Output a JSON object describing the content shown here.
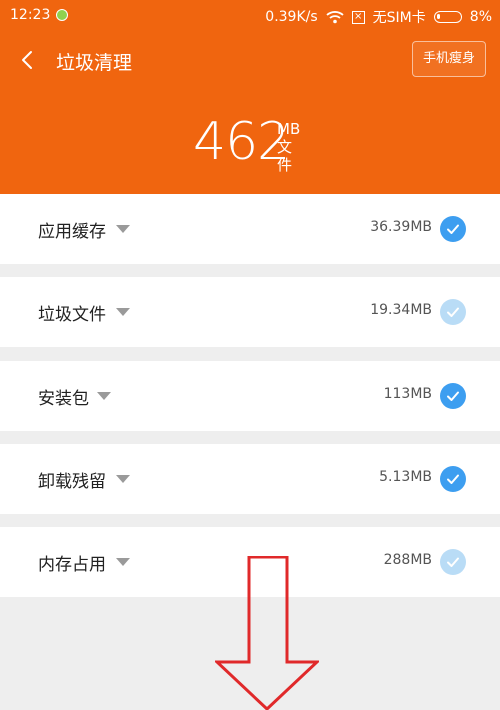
{
  "status": {
    "time": "12:23",
    "speed": "0.39K/s",
    "sim": "无SIM卡",
    "battery": "8%"
  },
  "header": {
    "title": "垃圾清理",
    "slim_button": "手机瘦身",
    "total_number": "462",
    "total_unit": "MB",
    "total_label": "文件"
  },
  "items": [
    {
      "label": "应用缓存",
      "size": "36.39MB",
      "checked": true
    },
    {
      "label": "垃圾文件",
      "size": "19.34MB",
      "checked": false
    },
    {
      "label": "安装包",
      "size": "113MB",
      "checked": true
    },
    {
      "label": "卸载残留",
      "size": "5.13MB",
      "checked": true
    },
    {
      "label": "内存占用",
      "size": "288MB",
      "checked": false
    }
  ],
  "icons": {
    "back": "chevron-left-icon",
    "check": "checkmark-icon",
    "expand": "caret-down-icon",
    "arrow": "down-arrow-annotation"
  },
  "colors": {
    "header": "#f0650f",
    "check_active": "#3d9ef0",
    "check_inactive": "#b9dcf6",
    "annotation_arrow": "#e0292a"
  }
}
